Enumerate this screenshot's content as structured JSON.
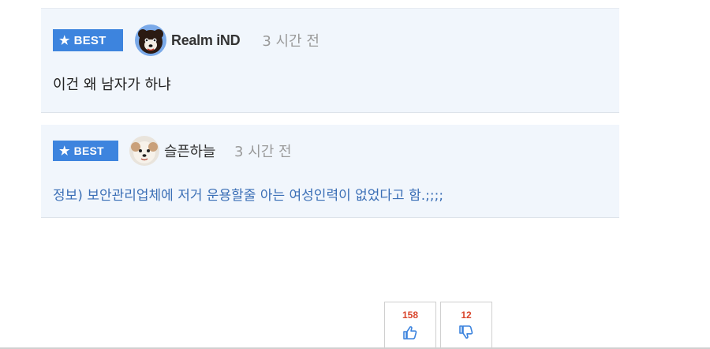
{
  "comments": [
    {
      "badge": "BEST",
      "nickname": "Realm iND",
      "time": "3 시간 전",
      "text": "이건 왜 남자가 하냐"
    },
    {
      "badge": "BEST",
      "nickname": "슬픈하늘",
      "time": "3 시간 전",
      "text": "정보) 보안관리업체에 저거 운용할줄 아는 여성인력이 없었다고 함.;;;;"
    }
  ],
  "votes": {
    "up_count": "158",
    "down_count": "12"
  },
  "colors": {
    "badge_bg": "#3d84de",
    "comment_bg": "#f1f6fc",
    "vote_count": "#d9452b",
    "highlight_text": "#3b6fb6"
  },
  "icons": {
    "badge": "star-icon",
    "upvote": "thumbs-up-icon",
    "downvote": "thumbs-down-icon"
  }
}
